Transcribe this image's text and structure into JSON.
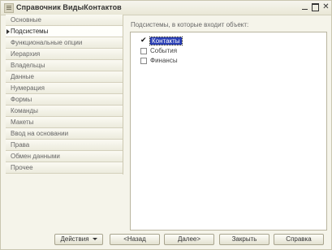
{
  "window": {
    "title": "Справочник ВидыКонтактов"
  },
  "sidebar": {
    "items": [
      {
        "label": "Основные"
      },
      {
        "label": "Подсистемы"
      },
      {
        "label": "Функциональные опции"
      },
      {
        "label": "Иерархия"
      },
      {
        "label": "Владельцы"
      },
      {
        "label": "Данные"
      },
      {
        "label": "Нумерация"
      },
      {
        "label": "Формы"
      },
      {
        "label": "Команды"
      },
      {
        "label": "Макеты"
      },
      {
        "label": "Ввод на основании"
      },
      {
        "label": "Права"
      },
      {
        "label": "Обмен данными"
      },
      {
        "label": "Прочее"
      }
    ],
    "active_index": 1
  },
  "content": {
    "heading": "Подсистемы, в которые входит объект:",
    "options": [
      {
        "label": "Контакты",
        "checked": true,
        "selected": true
      },
      {
        "label": "События",
        "checked": false,
        "selected": false
      },
      {
        "label": "Финансы",
        "checked": false,
        "selected": false
      }
    ]
  },
  "buttons": {
    "actions": "Действия",
    "back": "<Назад",
    "next": "Далее>",
    "close": "Закрыть",
    "help": "Справка"
  },
  "icons": {
    "minimize": "minimize-icon",
    "maximize": "maximize-icon",
    "close": "close-icon",
    "checkmark": "✔"
  }
}
